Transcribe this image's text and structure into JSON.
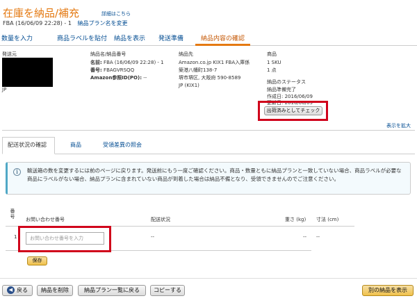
{
  "header": {
    "title": "在庫を納品/補充",
    "detail_link": "詳細はこちら",
    "subtitle": "FBA (16/06/09 22:28) - 1",
    "rename_link": "納品プラン名を変更"
  },
  "tabs": [
    "数量を入力",
    "商品ラベルを貼付",
    "納品を表示",
    "発送準備",
    "納品内容の確認"
  ],
  "active_tab": "納品内容の確認",
  "shipment": {
    "from_label": "発送元",
    "from_country": "JP",
    "name_header": "納品名/納品番号",
    "name_label": "名前:",
    "name_value": "FBA (16/06/09 22:28) - 1",
    "number_label": "番号:",
    "number_value": "FBAGVRSQQ",
    "ref_label": "Amazon参照ID(PO):",
    "ref_value": "--",
    "dest_label": "納品先",
    "dest_lines": [
      "Amazon.co.jp KIX1 FBA入庫係",
      "築港八幡町138-7",
      "堺市堺区, 大阪府 590-8589",
      "JP (KIX1)"
    ],
    "products_label": "商品",
    "sku_count": "1 SKU",
    "unit_count": "1 点",
    "status_label": "納品のステータス",
    "status_value": "納品準備完了",
    "created": "作成日: 2016/06/09",
    "updated": "更新日: 2016/06/09",
    "mark_shipped_button": "出荷済みとしてチェック"
  },
  "wider_link": "表示を拡大",
  "subtabs": [
    "配送状況の確認",
    "商品",
    "受領差異の照会"
  ],
  "info_message": "輸送箱の数を変更するには前のページに戻ります。発送前にもう一度ご確認ください。商品・数量ともに納品プランと一致していない場合、商品ラベルが必要な商品にラベルがない場合、納品プランに含まれていない商品が到着した場合は納品不備となり、受領できませんのでご注意ください。",
  "table": {
    "headers": {
      "number": "番号",
      "tracking": "お問い合わせ番号",
      "status": "配送状況",
      "weight": "重さ (kg)",
      "dims": "寸法 (cm)"
    },
    "rows": [
      {
        "number": "1",
        "status": "--",
        "weight": "--",
        "dims": "--"
      }
    ],
    "tracking_placeholder": "お問い合わせ番号を入力",
    "save_button": "保存"
  },
  "footer": {
    "back": "戻る",
    "delete": "納品を削除",
    "back_to_plans": "納品プラン一覧に戻る",
    "copy": "コピーする",
    "next": "別の納品を表示"
  },
  "colors": {
    "accent": "#e47911",
    "link": "#004b91",
    "highlight": "#d0021b"
  }
}
